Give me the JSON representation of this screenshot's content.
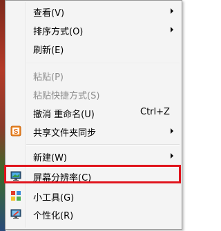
{
  "context_menu": {
    "items": {
      "view": {
        "label": "查看(V)"
      },
      "sort_by": {
        "label": "排序方式(O)"
      },
      "refresh": {
        "label": "刷新(E)"
      },
      "paste": {
        "label": "粘贴(P)"
      },
      "paste_shortcut": {
        "label": "粘贴快捷方式(S)"
      },
      "undo_rename": {
        "label": "撤消 重命名(U)",
        "shortcut": "Ctrl+Z"
      },
      "share_sync": {
        "label": "共享文件夹同步"
      },
      "new": {
        "label": "新建(W)"
      },
      "screen_resolution": {
        "label": "屏幕分辨率(C)"
      },
      "gadgets": {
        "label": "小工具(G)"
      },
      "personalize": {
        "label": "个性化(R)"
      }
    },
    "highlight_color": "#e0141c"
  }
}
